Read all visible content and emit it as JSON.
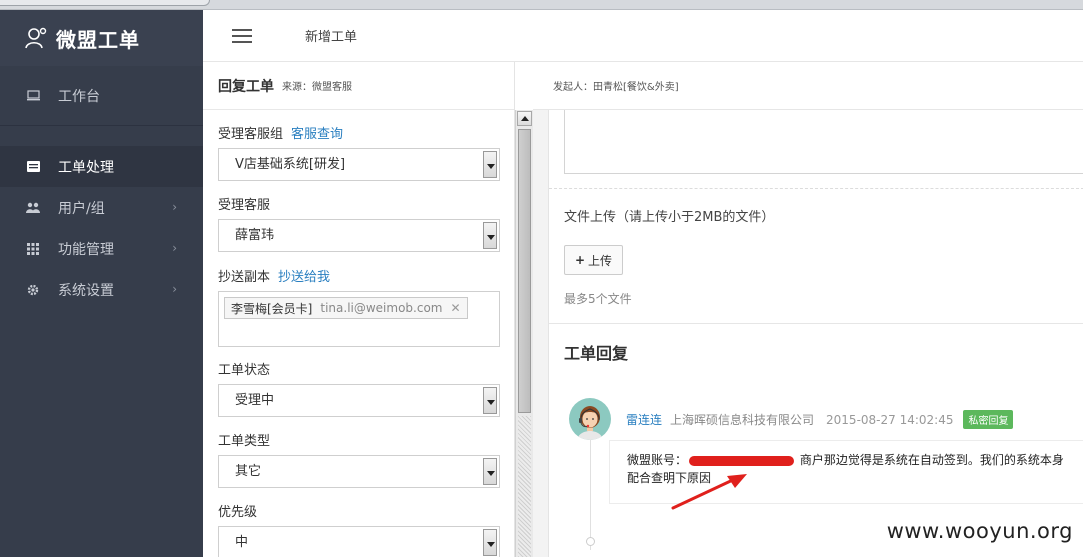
{
  "app": {
    "brand": "微盟工单"
  },
  "sidebar": {
    "items": [
      {
        "label": "工作台",
        "icon": "monitor-icon"
      },
      {
        "label": "工单处理",
        "icon": "ticket-icon"
      },
      {
        "label": "用户/组",
        "icon": "users-icon"
      },
      {
        "label": "功能管理",
        "icon": "grid-icon"
      },
      {
        "label": "系统设置",
        "icon": "gear-icon"
      }
    ]
  },
  "header": {
    "title": "新增工单"
  },
  "form": {
    "heading": "回复工单",
    "source": "来源：微盟客服",
    "group_label": "受理客服组",
    "group_link": "客服查询",
    "group_value": "V店基础系统[研发]",
    "agent_label": "受理客服",
    "agent_value": "薛富玮",
    "cc_label": "抄送副本",
    "cc_link": "抄送给我",
    "cc_tag_name": "李雪梅[会员卡]",
    "cc_tag_email": "tina.li@weimob.com",
    "status_label": "工单状态",
    "status_value": "受理中",
    "type_label": "工单类型",
    "type_value": "其它",
    "priority_label": "优先级",
    "priority_value": "中"
  },
  "right": {
    "initiator": "发起人：田青松[餐饮&外卖]",
    "upload_label": "文件上传（请上传小于2MB的文件）",
    "upload_button": "上传",
    "upload_hint": "最多5个文件",
    "reply_title": "工单回复",
    "reply": {
      "name": "雷连连",
      "company": "上海晖硕信息科技有限公司",
      "time": "2015-08-27 14:02:45",
      "badge": "私密回复",
      "line1_prefix": "微盟账号：",
      "line1_suffix": " 商户那边觉得是系统在自动签到。我们的系统本身",
      "line2": "配合查明下原因"
    }
  },
  "watermark": "www.wooyun.org"
}
